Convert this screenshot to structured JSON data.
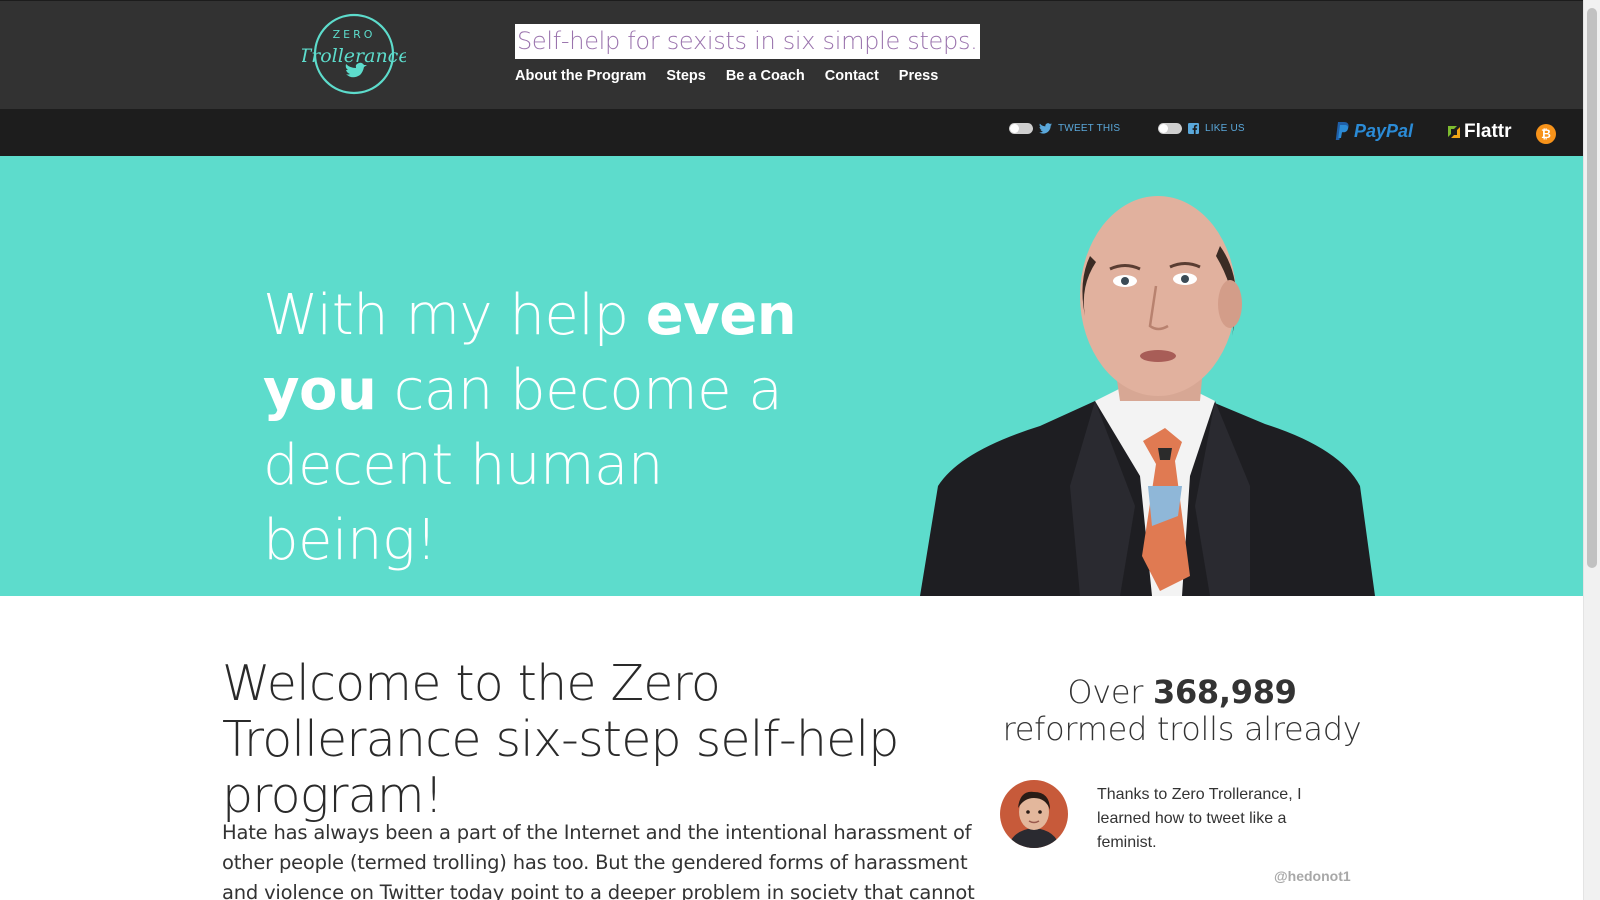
{
  "brand": {
    "logo_line1": "ZERO",
    "logo_line2": "Trollerance",
    "accent": "#5ddccc"
  },
  "header": {
    "tagline": "Self-help for sexists in six simple steps.",
    "nav": [
      {
        "label": "About the Program"
      },
      {
        "label": "Steps"
      },
      {
        "label": "Be a Coach"
      },
      {
        "label": "Contact"
      },
      {
        "label": "Press"
      }
    ]
  },
  "social": {
    "tweet_label": "TWEET THIS",
    "like_label": "LIKE US",
    "tweet_icon": "twitter-icon",
    "like_icon": "facebook-icon"
  },
  "donate": {
    "paypal_label": "PayPal",
    "flattr_label": "Flattr",
    "bitcoin_symbol": "₿"
  },
  "hero": {
    "line1_pre": "With my help ",
    "line1_bold": "even",
    "line2_bold": "you",
    "line2_post": " can become a",
    "line3": "decent human being!"
  },
  "main": {
    "welcome_title": "Welcome to the Zero Trollerance six-step self-help program!",
    "intro": "Hate has always been a part of the Internet and the intentional harassment of other people (termed trolling) has too. But the gendered forms of harassment and violence on Twitter today point to a deeper problem in society that cannot be"
  },
  "sidebar": {
    "counter_pre": "Over ",
    "counter_number": "368,989",
    "counter_post": " reformed trolls already",
    "testimonial": "Thanks to Zero Trollerance, I learned how to tweet like a feminist.",
    "handle": "@hedonot1"
  }
}
